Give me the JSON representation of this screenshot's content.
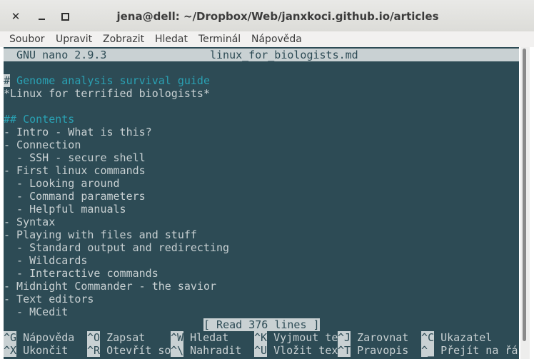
{
  "window": {
    "title": "jena@dell: ~/Dropbox/Web/janxkoci.github.io/articles"
  },
  "menubar": {
    "items": [
      "Soubor",
      "Upravit",
      "Zobrazit",
      "Hledat",
      "Terminál",
      "Nápověda"
    ]
  },
  "nano": {
    "version": "GNU nano 2.9.3",
    "filename": "linux_for_biologists.md",
    "cursor_char": "#",
    "line1_rest": " Genome analysis survival guide",
    "lines": [
      {
        "text": "*Linux for terrified biologists*",
        "style": "text"
      },
      {
        "text": "",
        "style": "text"
      },
      {
        "text": "## Contents",
        "style": "heading"
      },
      {
        "text": "- Intro - What is this?",
        "style": "text"
      },
      {
        "text": "- Connection",
        "style": "text"
      },
      {
        "text": "  - SSH - secure shell",
        "style": "text"
      },
      {
        "text": "- First linux commands",
        "style": "text"
      },
      {
        "text": "  - Looking around",
        "style": "text"
      },
      {
        "text": "  - Command parameters",
        "style": "text"
      },
      {
        "text": "  - Helpful manuals",
        "style": "text"
      },
      {
        "text": "- Syntax",
        "style": "text"
      },
      {
        "text": "- Playing with files and stuff",
        "style": "text"
      },
      {
        "text": "  - Standard output and redirecting",
        "style": "text"
      },
      {
        "text": "  - Wildcards",
        "style": "text"
      },
      {
        "text": "  - Interactive commands",
        "style": "text"
      },
      {
        "text": "- Midnight Commander - the savior",
        "style": "text"
      },
      {
        "text": "- Text editors",
        "style": "text"
      },
      {
        "text": "  - MCedit",
        "style": "text"
      }
    ],
    "status": "[ Read 376 lines ]",
    "shortcuts_row1": [
      {
        "key": "^G",
        "label": " Nápověda"
      },
      {
        "key": "^O",
        "label": " Zapsat"
      },
      {
        "key": "^W",
        "label": " Hledat"
      },
      {
        "key": "^K",
        "label": " Vyjmout te"
      },
      {
        "key": "^J",
        "label": " Zarovnat"
      },
      {
        "key": "^C",
        "label": " Ukazatel"
      }
    ],
    "shortcuts_row2": [
      {
        "key": "^X",
        "label": " Ukončit"
      },
      {
        "key": "^R",
        "label": " Otevřít so"
      },
      {
        "key": "^\\",
        "label": " Nahradit"
      },
      {
        "key": "^U",
        "label": " Vložit tex"
      },
      {
        "key": "^T",
        "label": " Pravopis"
      },
      {
        "key": "^_",
        "label": " Přejít na řá"
      }
    ]
  }
}
